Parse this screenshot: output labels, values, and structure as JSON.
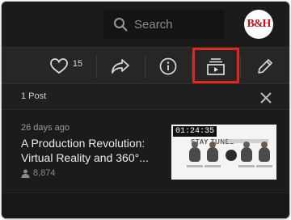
{
  "search": {
    "placeholder": "Search"
  },
  "avatar": {
    "label": "B&H"
  },
  "actions": {
    "like_count": "15",
    "items": [
      "like",
      "share",
      "info",
      "add-to-playlist",
      "edit"
    ]
  },
  "panel": {
    "post_count": "1 Post"
  },
  "post": {
    "age": "26 days ago",
    "title_line1": "A Production Revolution:",
    "title_line2": "Virtual Reality and 360°...",
    "views": "8,874",
    "duration": "01:24:35",
    "thumb_title": "STAY TUNED"
  },
  "colors": {
    "background": "#1b1b1b",
    "action_bar": "#262626",
    "highlight": "#e0281e",
    "brand_red": "#c4161c"
  }
}
